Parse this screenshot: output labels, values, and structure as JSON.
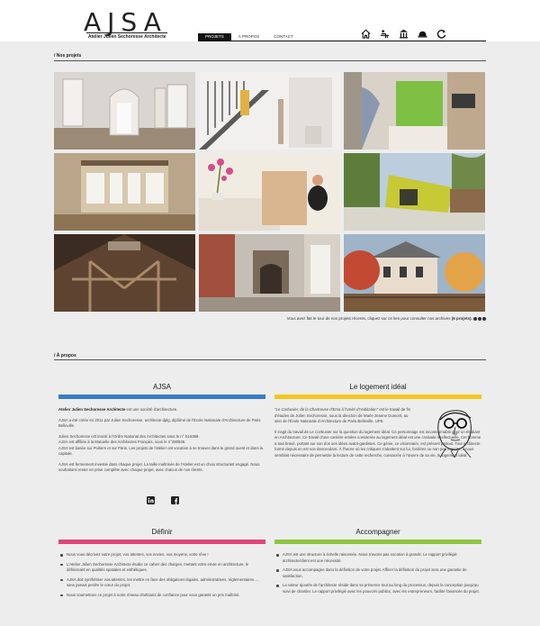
{
  "header": {
    "logo": "AJSA",
    "logo_subtitle": "Atelier Julien Sechoresse Architecte",
    "nav": [
      "Projets",
      "À propos",
      "Contact"
    ],
    "icons": [
      "home-icon",
      "desk-icon",
      "institution-icon",
      "helmet-icon",
      "refresh-icon"
    ]
  },
  "projects": {
    "label": "/ Nos projets",
    "photos": [
      {
        "name": "interior-doors",
        "palette": [
          "#cfcbc4",
          "#e9e6e1",
          "#9b8a76"
        ]
      },
      {
        "name": "staircase",
        "palette": [
          "#f2f1ef",
          "#3a3a3a",
          "#b0a79c"
        ]
      },
      {
        "name": "green-kitchen",
        "palette": [
          "#8bc34a",
          "#5a5a5a",
          "#c9b8a4"
        ]
      },
      {
        "name": "bay-window",
        "palette": [
          "#c5b49a",
          "#efe9df",
          "#8a7a63"
        ]
      },
      {
        "name": "orchid-kitchen",
        "palette": [
          "#f4efe6",
          "#d9b89a",
          "#d84c8b"
        ]
      },
      {
        "name": "yellow-extension",
        "palette": [
          "#c9cc3a",
          "#6a8a3a",
          "#b7c7d8"
        ]
      },
      {
        "name": "roof-frame",
        "palette": [
          "#6b4a32",
          "#2e241c",
          "#a88a6a"
        ]
      },
      {
        "name": "fireplace-ruin",
        "palette": [
          "#b7b2aa",
          "#7a6a5a",
          "#a74a3a"
        ]
      },
      {
        "name": "autumn-house",
        "palette": [
          "#c7523a",
          "#e6a74a",
          "#8aa1b8"
        ]
      }
    ],
    "caption_prefix": "Vous avez fait le tour de nos projets récents, cliquez sur ce lien pour consulter nos archives",
    "caption_link": "(6 projets)."
  },
  "about": {
    "label": "/ À propos",
    "ajsa": {
      "title": "AJSA",
      "color": "#3a7cc4",
      "lead_bold": "Atelier Julien Sechoresse Architecte",
      "lead_rest": " est une société d'architecture.",
      "paragraphs": [
        "AJSA a été créée en 2011 par Julien Sechoresse, architecte dplg, diplômé de l'École Nationale d'Architecture de Paris Belleville.",
        "Julien Sechoresse est inscrit à l'Ordre National des Architectes sous le n° S15369.\nAJSA est affiliée à la Mutuelle des Architectes Français, sous le n°280936.\nAJSA est basée sur Poitiers et sur Paris. Les projets de l'atelier ont vocation à se trouver dans le grand ouest et dans la capitale.",
        "AJSA est fermement investie dans chaque projet. La taille maîtrisée de l'Atelier est un choix structurant engagé. Nous souhaitons rester en prise complète avec chaque projet, avec chacun de nos clients."
      ],
      "social": [
        "linkedin-icon",
        "facebook-icon"
      ]
    },
    "logement": {
      "title": "Le logement idéal",
      "color": "#f2c81e",
      "quote": "\"Le Corbusier, de la Chartreuse d'Ema à l'Unité d'Habitation\"",
      "quote_rest": " est le travail de fin d'études de Julien Sechoresse, sous la direction de Marie Jeanne Dumont, au sein de l'École Nationale d'Architecture de Paris Belleville, UP8.",
      "paragraph": "Il s'agit du travail de Le Corbusier sur la question du logement idéal. Ce personnage est incontournable pour un étudiant en Architecture. Ce travail d'une carrière entière consacrée au logement idéal est une croisade intellectuelle. Cet homme a tout bravé, portant sur son dos ses idées avant-gardistes. Ce génie, ce visionnaire, est présent partout. Tout architecte formé depuis en est son descendant. À l'heure où les critiques s'abattent sur lui, fondées ou non peu importe, il nous semblait nécessaire de permettre la lecture de cette recherche, consacrée à l'œuvre de sa vie, le logement idéal."
    },
    "definir": {
      "title": "Définir",
      "color": "#e0457b",
      "items": [
        "Nous vous décrivez votre projet, vos attentes, vos envies, vos moyens, votre rêve !",
        "L'Atelier Julien Sechoresse Architecte étudie ce cahier des charges, mettant votre envie en architecture, le définissant en qualités spatiales et esthétiques.",
        "AJSA doit synthétiser vos attentes, les mettre en face des obligations légales, administratives, réglementaires…, sans jamais perdre le cœur du projet.",
        "Nous soumettons ce projet à notre réseau d'artisans de confiance pour vous garantir un prix maîtrisé."
      ]
    },
    "accompagner": {
      "title": "Accompagner",
      "color": "#8dc63f",
      "items": [
        "AJSA est une structure à échelle raisonnée. Nous n'avons pas vocation à grandir. Le rapport privilégié architecte/client est une nécessité.",
        "AJSA vous accompagne dans la définition de votre projet. Affiner la définition du projet sera une garantie de satisfaction.",
        "La valeur ajoutée de l'architecte réside dans sa présence tout au long du processus, depuis la conception jusqu'au suivi de chantier. Le rapport privilégié avec les pouvoirs publics, avec les entrepreneurs, facilite l'avancée du projet."
      ]
    }
  }
}
